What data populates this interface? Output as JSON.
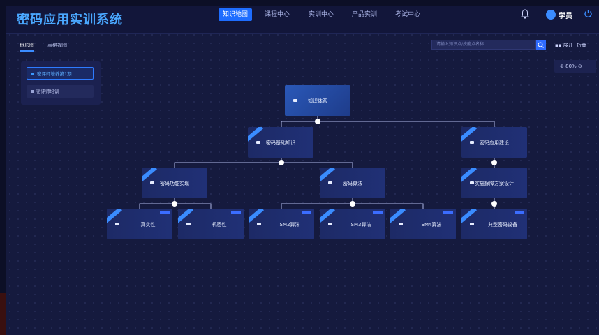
{
  "app": {
    "title": "密码应用实训系统"
  },
  "nav": [
    {
      "label": "知识地图",
      "active": true
    },
    {
      "label": "课程中心",
      "active": false
    },
    {
      "label": "实训中心",
      "active": false
    },
    {
      "label": "产品实训",
      "active": false
    },
    {
      "label": "考试中心",
      "active": false
    }
  ],
  "user": {
    "name": "学员"
  },
  "view_tabs": [
    {
      "label": "树形图",
      "active": true
    },
    {
      "label": "表格视图",
      "active": false
    }
  ],
  "search": {
    "placeholder": "请输入知识点/技能点名称"
  },
  "toolbar": {
    "expand_label": "展开",
    "collapse_label": "折叠"
  },
  "zoom": {
    "level": "80%"
  },
  "sidebar": {
    "items": [
      {
        "label": "密评师培养第1期",
        "active": true
      },
      {
        "label": "密评师培训",
        "active": false
      }
    ]
  },
  "tree": {
    "root": {
      "label": "知识体系"
    },
    "level1": [
      {
        "label": "密码基础知识"
      },
      {
        "label": "密码应用建设"
      }
    ],
    "level2": [
      {
        "label": "密码功能实现"
      },
      {
        "label": "密码算法"
      },
      {
        "label": "实施保障方案设计"
      }
    ],
    "level3": [
      {
        "label": "真实性"
      },
      {
        "label": "机密性"
      },
      {
        "label": "SM2算法"
      },
      {
        "label": "SM3算法"
      },
      {
        "label": "SM4算法"
      },
      {
        "label": "典型密码设备"
      }
    ]
  },
  "colors": {
    "accent": "#1e6dff",
    "brand": "#4aa8ff",
    "background": "#151a3e",
    "node": "#1d2a66"
  }
}
